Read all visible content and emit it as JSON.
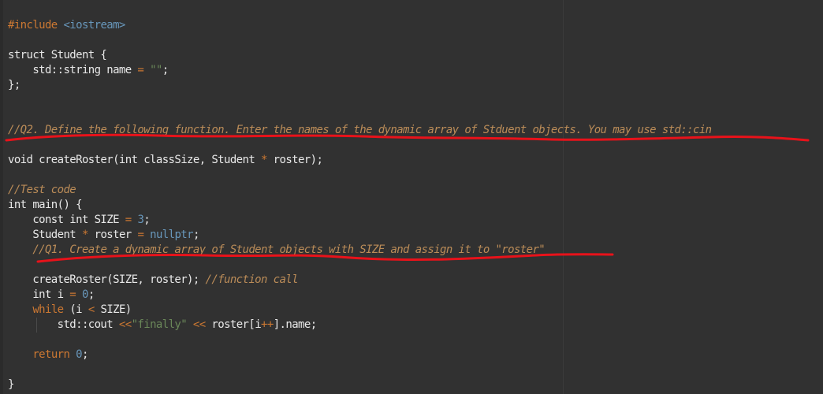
{
  "editor": {
    "lines": [
      {
        "tokens": [
          {
            "t": "#include ",
            "c": "pp"
          },
          {
            "t": "<iostream>",
            "c": "inc"
          }
        ]
      },
      {
        "tokens": [
          {
            "t": "struct Student {",
            "c": "plain"
          }
        ]
      },
      {
        "tokens": [
          {
            "t": "    std::string name ",
            "c": "plain"
          },
          {
            "t": "=",
            "c": "op"
          },
          {
            "t": " ",
            "c": "plain"
          },
          {
            "t": "\"\"",
            "c": "str"
          },
          {
            "t": ";",
            "c": "plain"
          }
        ]
      },
      {
        "tokens": [
          {
            "t": "};",
            "c": "plain"
          }
        ]
      },
      {
        "tokens": [
          {
            "t": "//Q2. Define the following function. Enter the names of the dynamic array of Stduent objects. You may use std::cin",
            "c": "cmt"
          }
        ]
      },
      {
        "tokens": [
          {
            "t": "void createRoster(int classSize, Student ",
            "c": "plain"
          },
          {
            "t": "*",
            "c": "op"
          },
          {
            "t": " roster);",
            "c": "plain"
          }
        ]
      },
      {
        "tokens": [
          {
            "t": "//Test code",
            "c": "cmt"
          }
        ]
      },
      {
        "tokens": [
          {
            "t": "int main() {",
            "c": "plain"
          }
        ]
      },
      {
        "tokens": [
          {
            "t": "    const int SIZE ",
            "c": "plain"
          },
          {
            "t": "=",
            "c": "op"
          },
          {
            "t": " ",
            "c": "plain"
          },
          {
            "t": "3",
            "c": "num"
          },
          {
            "t": ";",
            "c": "plain"
          }
        ]
      },
      {
        "tokens": [
          {
            "t": "    Student ",
            "c": "plain"
          },
          {
            "t": "*",
            "c": "op"
          },
          {
            "t": " roster ",
            "c": "plain"
          },
          {
            "t": "=",
            "c": "op"
          },
          {
            "t": " ",
            "c": "plain"
          },
          {
            "t": "nullptr",
            "c": "nul"
          },
          {
            "t": ";",
            "c": "plain"
          }
        ]
      },
      {
        "tokens": [
          {
            "t": "    ",
            "c": "plain"
          },
          {
            "t": "//Q1. Create a dynamic array of Student objects with SIZE and assign it to \"roster\"",
            "c": "cmt"
          }
        ]
      },
      {
        "tokens": [
          {
            "t": "    createRoster(SIZE, roster); ",
            "c": "plain"
          },
          {
            "t": "//function call",
            "c": "cmt"
          }
        ]
      },
      {
        "tokens": [
          {
            "t": "    int i ",
            "c": "plain"
          },
          {
            "t": "=",
            "c": "op"
          },
          {
            "t": " ",
            "c": "plain"
          },
          {
            "t": "0",
            "c": "num"
          },
          {
            "t": ";",
            "c": "plain"
          }
        ]
      },
      {
        "tokens": [
          {
            "t": "    ",
            "c": "plain"
          },
          {
            "t": "while",
            "c": "kw"
          },
          {
            "t": " (i ",
            "c": "plain"
          },
          {
            "t": "<",
            "c": "op"
          },
          {
            "t": " SIZE)",
            "c": "plain"
          }
        ]
      },
      {
        "tokens": [
          {
            "t": "        std::cout ",
            "c": "plain"
          },
          {
            "t": "<<",
            "c": "op"
          },
          {
            "t": "\"finally\"",
            "c": "str"
          },
          {
            "t": " ",
            "c": "plain"
          },
          {
            "t": "<<",
            "c": "op"
          },
          {
            "t": " roster[i",
            "c": "plain"
          },
          {
            "t": "++",
            "c": "op"
          },
          {
            "t": "].name;",
            "c": "plain"
          }
        ]
      },
      {
        "tokens": [
          {
            "t": "    ",
            "c": "plain"
          },
          {
            "t": "return",
            "c": "kw"
          },
          {
            "t": " ",
            "c": "plain"
          },
          {
            "t": "0",
            "c": "num"
          },
          {
            "t": ";",
            "c": "plain"
          }
        ]
      },
      {
        "tokens": [
          {
            "t": "}",
            "c": "plain"
          }
        ]
      }
    ]
  },
  "annotations": {
    "underline_color": "#e8121a",
    "underlined_lines": [
      "Q2 comment",
      "Q1 comment"
    ]
  }
}
